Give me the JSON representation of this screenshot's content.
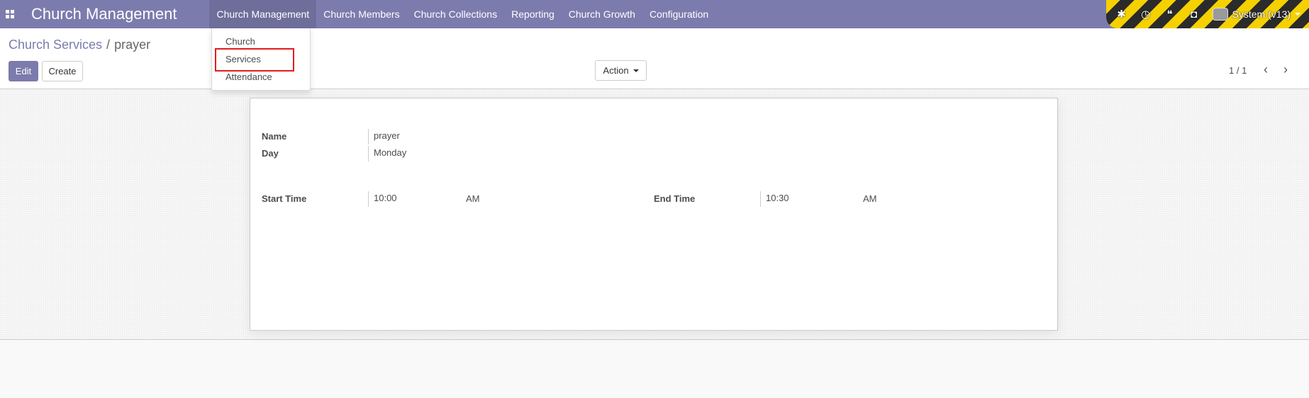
{
  "navbar": {
    "brand": "Church Management",
    "menu": [
      {
        "label": "Church Management"
      },
      {
        "label": "Church Members"
      },
      {
        "label": "Church Collections"
      },
      {
        "label": "Reporting"
      },
      {
        "label": "Church Growth"
      },
      {
        "label": "Configuration"
      }
    ],
    "user_label": "System (v13)",
    "color": "#7c7bad"
  },
  "dropdown": {
    "items": [
      {
        "label": "Church"
      },
      {
        "label": "Services"
      },
      {
        "label": "Attendance"
      }
    ],
    "highlighted_item": "Services",
    "highlight_color": "#e41b1b"
  },
  "breadcrumb": {
    "parent": "Church Services",
    "separator": "/",
    "current": "prayer"
  },
  "toolbar": {
    "edit_label": "Edit",
    "create_label": "Create",
    "action_label": "Action"
  },
  "pager": {
    "label": "1 / 1"
  },
  "form": {
    "name": {
      "label": "Name",
      "value": "prayer"
    },
    "day": {
      "label": "Day",
      "value": "Monday"
    },
    "start_time": {
      "label": "Start Time",
      "value": "10:00",
      "ampm": "AM"
    },
    "end_time": {
      "label": "End Time",
      "value": "10:30",
      "ampm": "AM"
    }
  }
}
